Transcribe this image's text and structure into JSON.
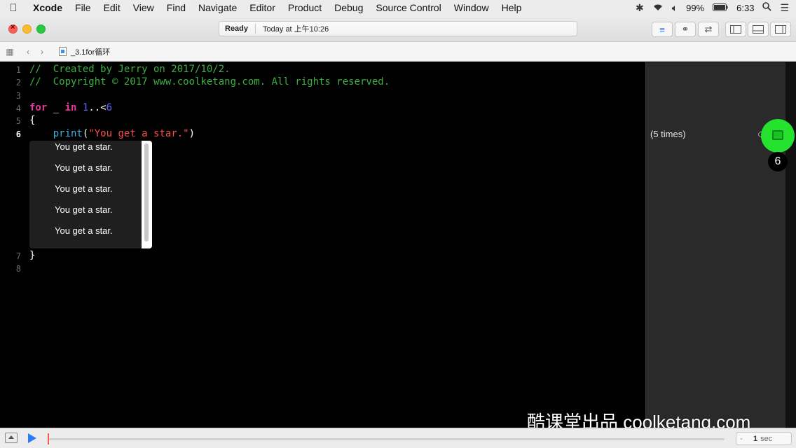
{
  "menubar": {
    "app_name": "Xcode",
    "items": [
      "File",
      "Edit",
      "View",
      "Find",
      "Navigate",
      "Editor",
      "Product",
      "Debug",
      "Source Control",
      "Window",
      "Help"
    ],
    "battery": "99%",
    "time": "6:33",
    "icons": [
      "apple-icon",
      "bluetooth-icon",
      "wifi-icon",
      "volume-icon",
      "battery-icon",
      "search-icon",
      "list-icon"
    ]
  },
  "toolbar": {
    "status": "Ready",
    "timestamp": "Today at 上午10:26",
    "editor_icons": [
      "standard-editor-icon",
      "assistant-editor-icon",
      "version-editor-icon"
    ],
    "panel_icons": [
      "navigator-toggle-icon",
      "debug-area-toggle-icon",
      "utilities-toggle-icon"
    ]
  },
  "jumpbar": {
    "file_name": "_3.1for循环"
  },
  "editor": {
    "line_numbers": [
      "1",
      "2",
      "3",
      "4",
      "5",
      "6",
      "7",
      "8"
    ],
    "current_line": "6",
    "comment1": "//  Created by Jerry on 2017/10/2.",
    "comment2": "//  Copyright © 2017 www.coolketang.com. All rights reserved.",
    "for_kw": "for",
    "underscore": "_",
    "in_kw": "in",
    "range_start": "1",
    "range_op": "..<",
    "range_end": "6",
    "open_brace": "{",
    "fn_name": "print",
    "paren_open": "(",
    "string_literal": "\"You get a star.\"",
    "paren_close": ")",
    "close_brace": "}"
  },
  "popup": {
    "items": [
      "You get a star.",
      "You get a star.",
      "You get a star.",
      "You get a star.",
      "You get a star."
    ]
  },
  "results": {
    "count_text": "(5 times)",
    "step_badge": "6"
  },
  "watermark": "酷课堂出品 coolketang.com",
  "debugbar": {
    "speed_value": "1",
    "speed_unit": "sec",
    "minus": "-",
    "progress": 0.0
  }
}
